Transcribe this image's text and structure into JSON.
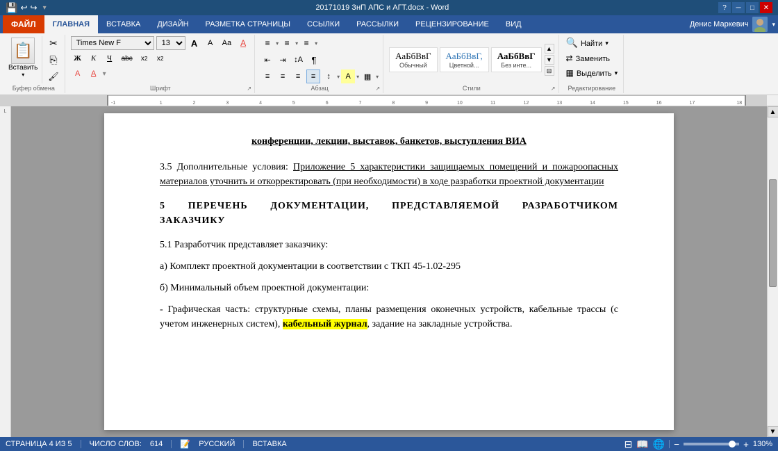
{
  "titlebar": {
    "title": "20171019 ЗнП АПС и АГТ.docx - Word",
    "help_btn": "?",
    "minimize_btn": "─",
    "restore_btn": "□",
    "close_btn": "✕"
  },
  "quickaccess": {
    "save_label": "💾",
    "undo_label": "↩",
    "redo_label": "↪"
  },
  "menu": {
    "file_label": "ФАЙЛ",
    "tabs": [
      "ГЛАВНАЯ",
      "ВСТАВКА",
      "ДИЗАЙН",
      "РАЗМЕТКА СТРАНИЦЫ",
      "ССЫЛКИ",
      "РАССЫЛКИ",
      "РЕЦЕНЗИРОВАНИЕ",
      "ВИД"
    ],
    "active_tab": "ГЛАВНАЯ",
    "user_name": "Денис Маркевич"
  },
  "toolbar": {
    "clipboard": {
      "label": "Буфер обмена",
      "paste_label": "Вставить"
    },
    "font": {
      "label": "Шрифт",
      "font_name": "Times New F",
      "font_size": "13",
      "grow_label": "A",
      "shrink_label": "A",
      "case_label": "Aa",
      "clear_label": "A",
      "bold_label": "Ж",
      "italic_label": "К",
      "underline_label": "Ч",
      "strikethrough_label": "abc",
      "subscript_label": "x₂",
      "superscript_label": "x²",
      "color_label": "A",
      "highlight_label": "A"
    },
    "paragraph": {
      "label": "Абзац"
    },
    "styles": {
      "label": "Стили",
      "style1": "АаБбВвГ",
      "style1_name": "Обычный",
      "style2": "АаБбВвГ,",
      "style2_name": "Цветной...",
      "style3": "АаБбВвГ",
      "style3_name": "Без инте..."
    },
    "editing": {
      "label": "Редактирование",
      "find_label": "Найти",
      "replace_label": "Заменить",
      "select_label": "Выделить"
    }
  },
  "document": {
    "content": [
      {
        "type": "top",
        "text": "конференции, лекции, выставок, банкетов, выступления ВИА"
      },
      {
        "type": "para35",
        "prefix": "3.5 Дополнительные условия: ",
        "underline": "Приложение 5 характеристики защищаемых помещений и пожароопасных материалов уточнить и откорректировать (при необходимости) в ходе разработки проектной документации"
      },
      {
        "type": "heading5",
        "text": "5   ПЕРЕЧЕНЬ   ДОКУМЕНТАЦИИ,   ПРЕДСТАВЛЯЕМОЙ   РАЗРАБОТЧИКОМ ЗАКАЗЧИКУ"
      },
      {
        "type": "para51",
        "text": "5.1 Разработчик представляет заказчику:"
      },
      {
        "type": "para_a",
        "text": "а) Комплект проектной документации в соответствии с ТКП 45-1.02-295"
      },
      {
        "type": "para_b",
        "text": "б) Минимальный объем проектной документации:"
      },
      {
        "type": "para_dash",
        "text_before": "- Графическая часть: структурные схемы, планы размещения оконечных устройств, кабельные трассы (с учетом инженерных систем), ",
        "highlight": "кабельный журнал",
        "text_after": ", задание на закладные устройства."
      }
    ]
  },
  "statusbar": {
    "page_info": "СТРАНИЦА 4 ИЗ 5",
    "words_label": "ЧИСЛО СЛОВ:",
    "words_count": "614",
    "lang": "РУССКИЙ",
    "mode": "ВСТАВКА",
    "zoom_level": "130%"
  }
}
